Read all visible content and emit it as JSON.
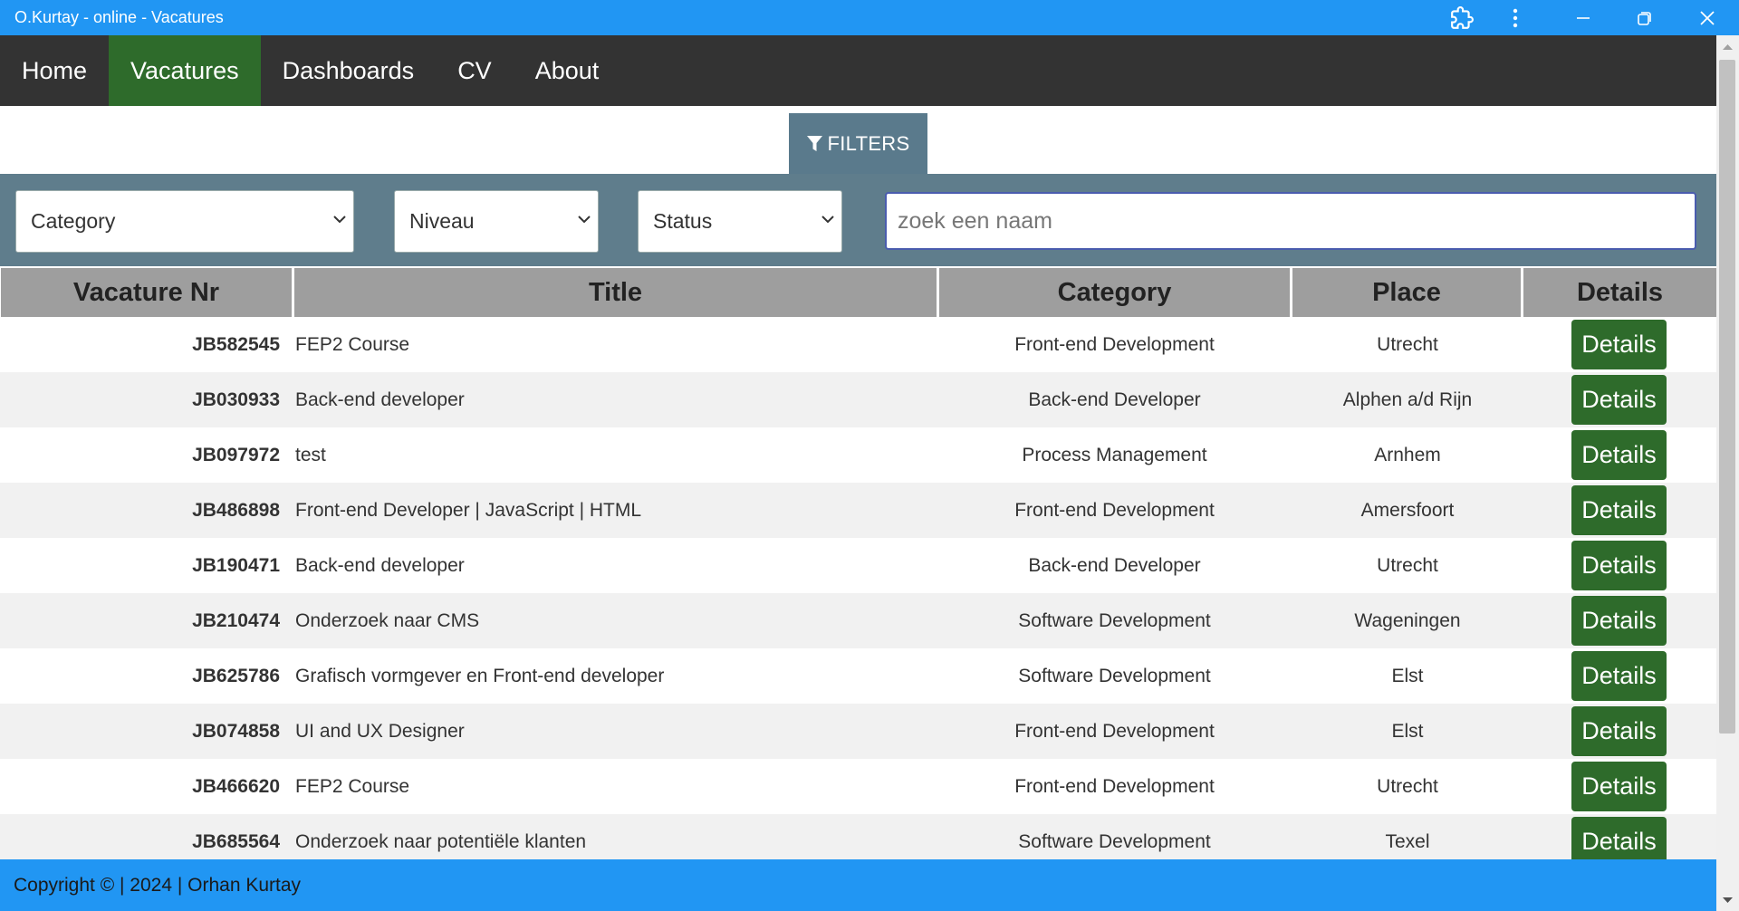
{
  "window": {
    "title": "O.Kurtay - online - Vacatures",
    "icons": [
      "extension-icon",
      "more-vert-icon",
      "minimize-icon",
      "restore-icon",
      "close-icon"
    ]
  },
  "nav": {
    "items": [
      {
        "label": "Home",
        "active": false
      },
      {
        "label": "Vacatures",
        "active": true
      },
      {
        "label": "Dashboards",
        "active": false
      },
      {
        "label": "CV",
        "active": false
      },
      {
        "label": "About",
        "active": false
      }
    ]
  },
  "filters": {
    "button_label": "FILTERS",
    "category_placeholder": "Category",
    "niveau_placeholder": "Niveau",
    "status_placeholder": "Status",
    "search_placeholder": "zoek een naam"
  },
  "table": {
    "headers": [
      "Vacature Nr",
      "Title",
      "Category",
      "Place",
      "Details"
    ],
    "details_label": "Details",
    "rows": [
      {
        "nr": "JB582545",
        "title": "FEP2 Course",
        "category": "Front-end Development",
        "place": "Utrecht"
      },
      {
        "nr": "JB030933",
        "title": "Back-end developer",
        "category": "Back-end Developer",
        "place": "Alphen a/d Rijn"
      },
      {
        "nr": "JB097972",
        "title": "test",
        "category": "Process Management",
        "place": "Arnhem"
      },
      {
        "nr": "JB486898",
        "title": "Front-end Developer | JavaScript | HTML",
        "category": "Front-end Development",
        "place": "Amersfoort"
      },
      {
        "nr": "JB190471",
        "title": "Back-end developer",
        "category": "Back-end Developer",
        "place": "Utrecht"
      },
      {
        "nr": "JB210474",
        "title": "Onderzoek naar CMS",
        "category": "Software Development",
        "place": "Wageningen"
      },
      {
        "nr": "JB625786",
        "title": "Grafisch vormgever en Front-end developer",
        "category": "Software Development",
        "place": "Elst"
      },
      {
        "nr": "JB074858",
        "title": "UI and UX Designer",
        "category": "Front-end Development",
        "place": "Elst"
      },
      {
        "nr": "JB466620",
        "title": "FEP2 Course",
        "category": "Front-end Development",
        "place": "Utrecht"
      },
      {
        "nr": "JB685564",
        "title": "Onderzoek naar potentiële klanten",
        "category": "Software Development",
        "place": "Texel"
      }
    ]
  },
  "footer": {
    "text": "Copyright © | 2024 | Orhan Kurtay"
  },
  "colors": {
    "titlebar": "#2196f3",
    "nav_bg": "#333333",
    "nav_active": "#2e6b2b",
    "filter_bar": "#5f7d8c",
    "details_button": "#2e6b2b",
    "table_header": "#9e9e9e",
    "footer": "#2196f3"
  }
}
